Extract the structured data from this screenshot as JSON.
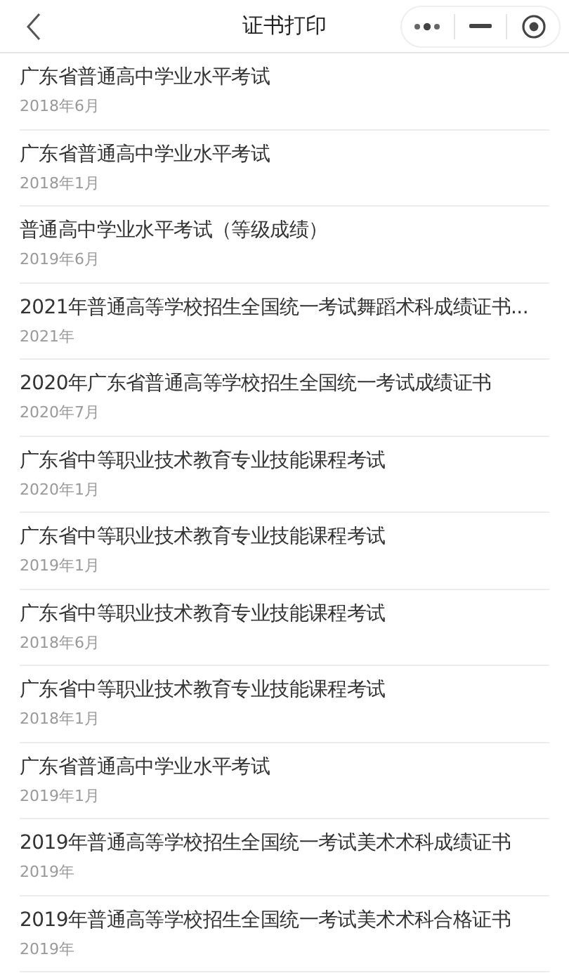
{
  "header": {
    "title": "证书打印"
  },
  "certificates": [
    {
      "title": "广东省普通高中学业水平考试",
      "date": "2018年6月"
    },
    {
      "title": "广东省普通高中学业水平考试",
      "date": "2018年1月"
    },
    {
      "title": "普通高中学业水平考试（等级成绩）",
      "date": "2019年6月"
    },
    {
      "title": "2021年普通高等学校招生全国统一考试舞蹈术科成绩证书...",
      "date": "2021年"
    },
    {
      "title": "2020年广东省普通高等学校招生全国统一考试成绩证书",
      "date": "2020年7月"
    },
    {
      "title": "广东省中等职业技术教育专业技能课程考试",
      "date": "2020年1月"
    },
    {
      "title": "广东省中等职业技术教育专业技能课程考试",
      "date": "2019年1月"
    },
    {
      "title": "广东省中等职业技术教育专业技能课程考试",
      "date": "2018年6月"
    },
    {
      "title": "广东省中等职业技术教育专业技能课程考试",
      "date": "2018年1月"
    },
    {
      "title": "广东省普通高中学业水平考试",
      "date": "2019年1月"
    },
    {
      "title": "2019年普通高等学校招生全国统一考试美术术科成绩证书",
      "date": "2019年"
    },
    {
      "title": "2019年普通高等学校招生全国统一考试美术术科合格证书",
      "date": "2019年"
    }
  ]
}
